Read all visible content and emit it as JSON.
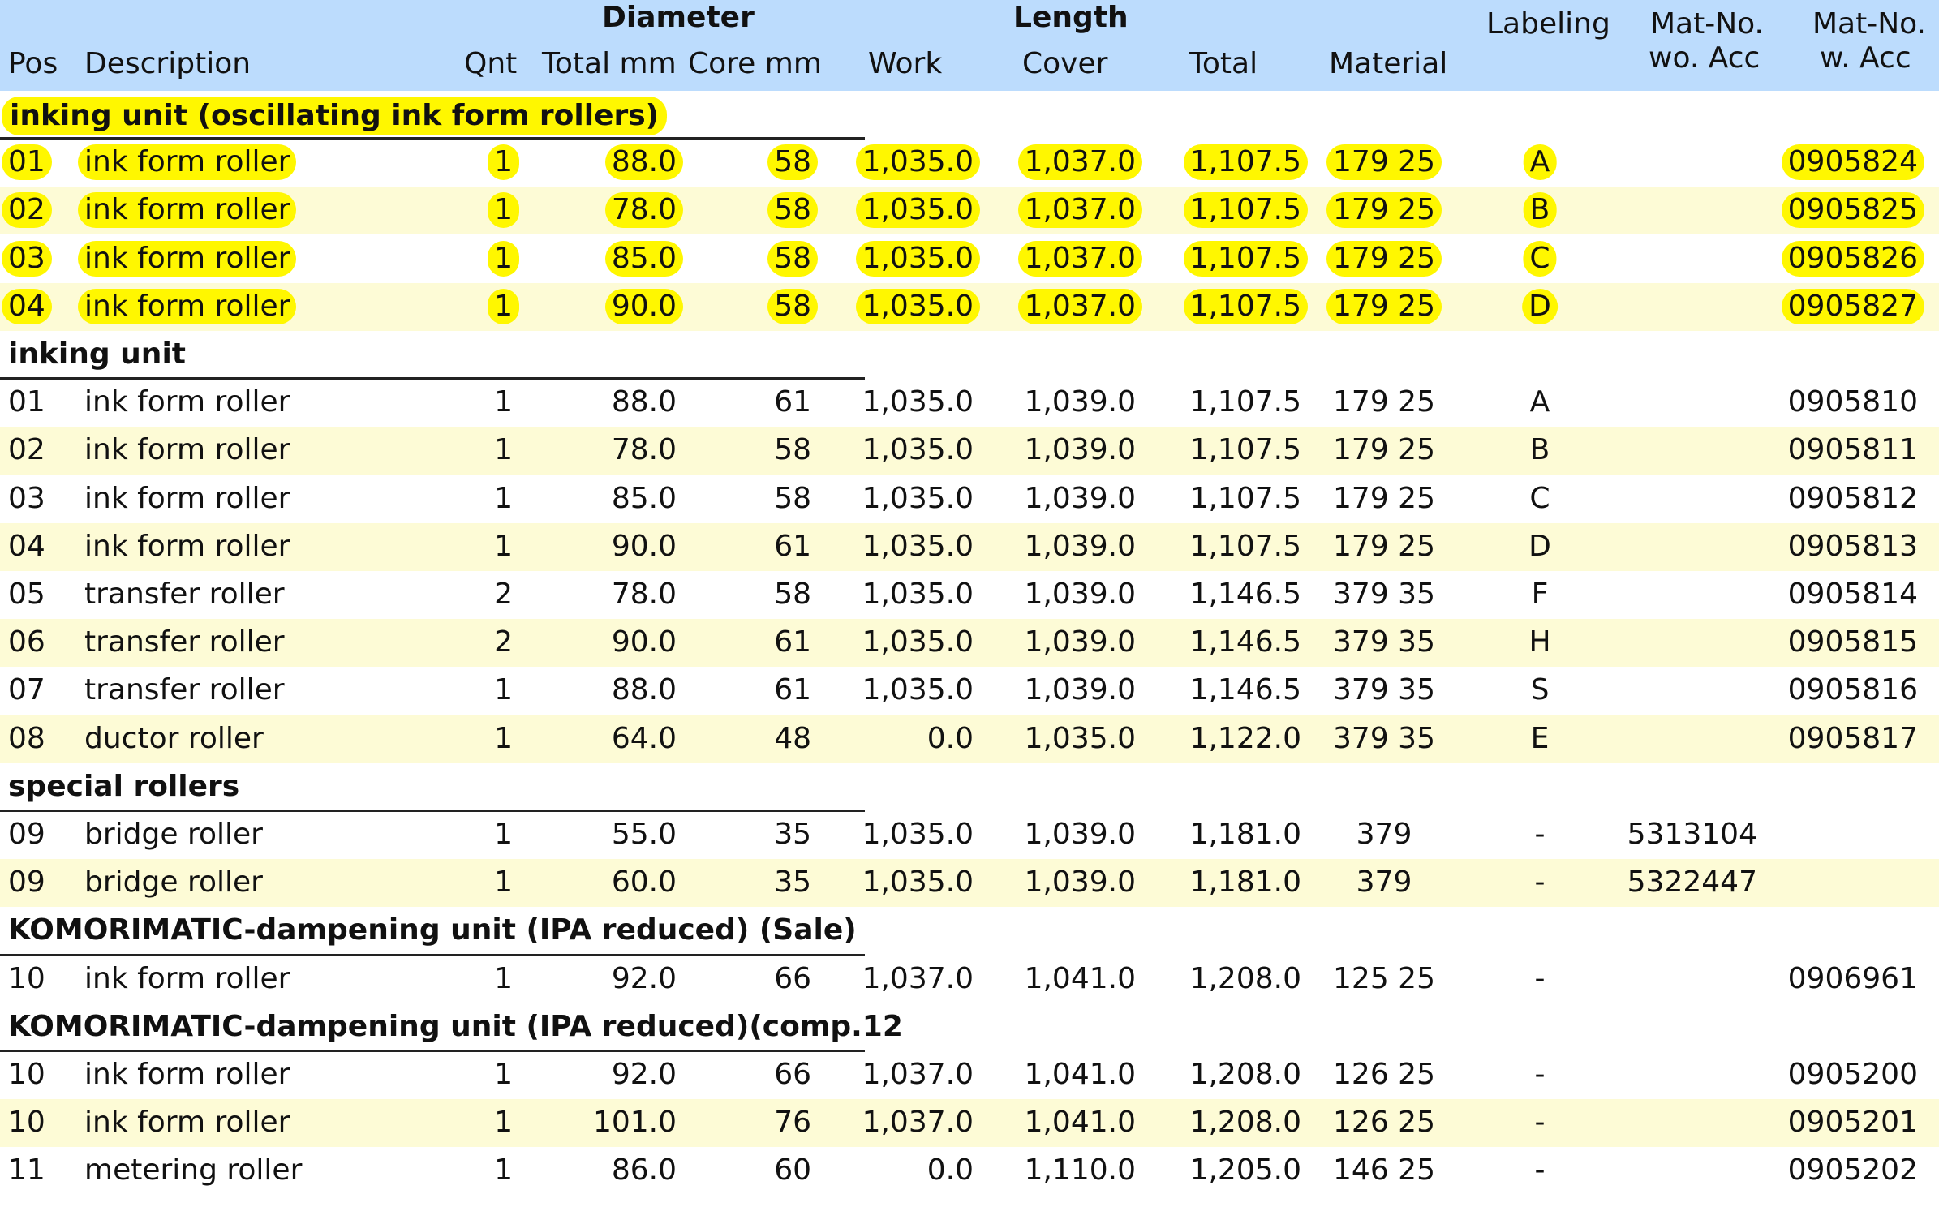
{
  "headers": {
    "group_diameter": "Diameter",
    "group_length": "Length",
    "pos": "Pos",
    "description": "Description",
    "qnt": "Qnt",
    "total_mm": "Total mm",
    "core_mm": "Core mm",
    "work": "Work",
    "cover": "Cover",
    "total": "Total",
    "material": "Material",
    "labeling": "Labeling",
    "mat_wo_1": "Mat-No.",
    "mat_wo_2": "wo. Acc",
    "mat_w_1": "Mat-No.",
    "mat_w_2": "w. Acc"
  },
  "rows": [
    {
      "type": "section",
      "title": "inking unit (oscillating ink form rollers)",
      "highlight": true
    },
    {
      "type": "item",
      "highlight": true,
      "pos": "01",
      "description": "ink form roller",
      "qnt": "1",
      "total_mm": "88.0",
      "core_mm": "58",
      "work": "1,035.0",
      "cover": "1,037.0",
      "total": "1,107.5",
      "material": "179 25",
      "labeling": "A",
      "mat_wo": "",
      "mat_w": "0905824"
    },
    {
      "type": "item",
      "highlight": true,
      "pos": "02",
      "description": "ink form roller",
      "qnt": "1",
      "total_mm": "78.0",
      "core_mm": "58",
      "work": "1,035.0",
      "cover": "1,037.0",
      "total": "1,107.5",
      "material": "179 25",
      "labeling": "B",
      "mat_wo": "",
      "mat_w": "0905825"
    },
    {
      "type": "item",
      "highlight": true,
      "pos": "03",
      "description": "ink form roller",
      "qnt": "1",
      "total_mm": "85.0",
      "core_mm": "58",
      "work": "1,035.0",
      "cover": "1,037.0",
      "total": "1,107.5",
      "material": "179 25",
      "labeling": "C",
      "mat_wo": "",
      "mat_w": "0905826"
    },
    {
      "type": "item",
      "highlight": true,
      "pos": "04",
      "description": "ink form roller",
      "qnt": "1",
      "total_mm": "90.0",
      "core_mm": "58",
      "work": "1,035.0",
      "cover": "1,037.0",
      "total": "1,107.5",
      "material": "179 25",
      "labeling": "D",
      "mat_wo": "",
      "mat_w": "0905827"
    },
    {
      "type": "section",
      "title": "inking unit",
      "highlight": false
    },
    {
      "type": "item",
      "highlight": false,
      "pos": "01",
      "description": "ink form roller",
      "qnt": "1",
      "total_mm": "88.0",
      "core_mm": "61",
      "work": "1,035.0",
      "cover": "1,039.0",
      "total": "1,107.5",
      "material": "179 25",
      "labeling": "A",
      "mat_wo": "",
      "mat_w": "0905810"
    },
    {
      "type": "item",
      "highlight": false,
      "pos": "02",
      "description": "ink form roller",
      "qnt": "1",
      "total_mm": "78.0",
      "core_mm": "58",
      "work": "1,035.0",
      "cover": "1,039.0",
      "total": "1,107.5",
      "material": "179 25",
      "labeling": "B",
      "mat_wo": "",
      "mat_w": "0905811"
    },
    {
      "type": "item",
      "highlight": false,
      "pos": "03",
      "description": "ink form roller",
      "qnt": "1",
      "total_mm": "85.0",
      "core_mm": "58",
      "work": "1,035.0",
      "cover": "1,039.0",
      "total": "1,107.5",
      "material": "179 25",
      "labeling": "C",
      "mat_wo": "",
      "mat_w": "0905812"
    },
    {
      "type": "item",
      "highlight": false,
      "pos": "04",
      "description": "ink form roller",
      "qnt": "1",
      "total_mm": "90.0",
      "core_mm": "61",
      "work": "1,035.0",
      "cover": "1,039.0",
      "total": "1,107.5",
      "material": "179 25",
      "labeling": "D",
      "mat_wo": "",
      "mat_w": "0905813"
    },
    {
      "type": "item",
      "highlight": false,
      "pos": "05",
      "description": "transfer roller",
      "qnt": "2",
      "total_mm": "78.0",
      "core_mm": "58",
      "work": "1,035.0",
      "cover": "1,039.0",
      "total": "1,146.5",
      "material": "379 35",
      "labeling": "F",
      "mat_wo": "",
      "mat_w": "0905814"
    },
    {
      "type": "item",
      "highlight": false,
      "pos": "06",
      "description": "transfer roller",
      "qnt": "2",
      "total_mm": "90.0",
      "core_mm": "61",
      "work": "1,035.0",
      "cover": "1,039.0",
      "total": "1,146.5",
      "material": "379 35",
      "labeling": "H",
      "mat_wo": "",
      "mat_w": "0905815"
    },
    {
      "type": "item",
      "highlight": false,
      "pos": "07",
      "description": "transfer roller",
      "qnt": "1",
      "total_mm": "88.0",
      "core_mm": "61",
      "work": "1,035.0",
      "cover": "1,039.0",
      "total": "1,146.5",
      "material": "379 35",
      "labeling": "S",
      "mat_wo": "",
      "mat_w": "0905816"
    },
    {
      "type": "item",
      "highlight": false,
      "pos": "08",
      "description": "ductor roller",
      "qnt": "1",
      "total_mm": "64.0",
      "core_mm": "48",
      "work": "0.0",
      "cover": "1,035.0",
      "total": "1,122.0",
      "material": "379 35",
      "labeling": "E",
      "mat_wo": "",
      "mat_w": "0905817"
    },
    {
      "type": "section",
      "title": "special rollers",
      "highlight": false
    },
    {
      "type": "item",
      "highlight": false,
      "pos": "09",
      "description": "bridge roller",
      "qnt": "1",
      "total_mm": "55.0",
      "core_mm": "35",
      "work": "1,035.0",
      "cover": "1,039.0",
      "total": "1,181.0",
      "material": "379",
      "labeling": "-",
      "mat_wo": "5313104",
      "mat_w": ""
    },
    {
      "type": "item",
      "highlight": false,
      "pos": "09",
      "description": "bridge roller",
      "qnt": "1",
      "total_mm": "60.0",
      "core_mm": "35",
      "work": "1,035.0",
      "cover": "1,039.0",
      "total": "1,181.0",
      "material": "379",
      "labeling": "-",
      "mat_wo": "5322447",
      "mat_w": ""
    },
    {
      "type": "section",
      "title": "KOMORIMATIC-dampening unit (IPA reduced) (Sale)",
      "highlight": false
    },
    {
      "type": "item",
      "highlight": false,
      "pos": "10",
      "description": "ink form roller",
      "qnt": "1",
      "total_mm": "92.0",
      "core_mm": "66",
      "work": "1,037.0",
      "cover": "1,041.0",
      "total": "1,208.0",
      "material": "125 25",
      "labeling": "-",
      "mat_wo": "",
      "mat_w": "0906961"
    },
    {
      "type": "section",
      "title": "KOMORIMATIC-dampening unit (IPA reduced)(comp.12",
      "highlight": false
    },
    {
      "type": "item",
      "highlight": false,
      "pos": "10",
      "description": "ink form roller",
      "qnt": "1",
      "total_mm": "92.0",
      "core_mm": "66",
      "work": "1,037.0",
      "cover": "1,041.0",
      "total": "1,208.0",
      "material": "126 25",
      "labeling": "-",
      "mat_wo": "",
      "mat_w": "0905200"
    },
    {
      "type": "item",
      "highlight": false,
      "pos": "10",
      "description": "ink form roller",
      "qnt": "1",
      "total_mm": "101.0",
      "core_mm": "76",
      "work": "1,037.0",
      "cover": "1,041.0",
      "total": "1,208.0",
      "material": "126 25",
      "labeling": "-",
      "mat_wo": "",
      "mat_w": "0905201"
    },
    {
      "type": "item",
      "highlight": false,
      "pos": "11",
      "description": "metering roller",
      "qnt": "1",
      "total_mm": "86.0",
      "core_mm": "60",
      "work": "0.0",
      "cover": "1,110.0",
      "total": "1,205.0",
      "material": "146 25",
      "labeling": "-",
      "mat_wo": "",
      "mat_w": "0905202"
    }
  ],
  "colors": {
    "header_bg": "#bcdcfd",
    "band_bg": "#fdfbd6",
    "highlight": "#fff700"
  }
}
